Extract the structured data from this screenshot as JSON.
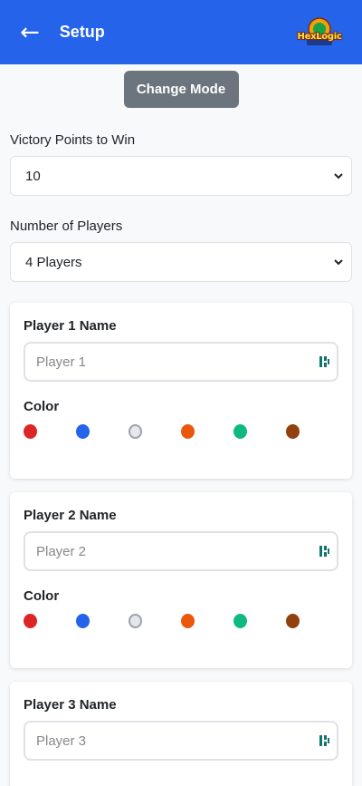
{
  "header": {
    "back_icon": "arrow-left-icon",
    "title": "Setup",
    "logo_text": "HexLogic"
  },
  "change_mode_label": "Change Mode",
  "victory": {
    "label": "Victory Points to Win",
    "value": "10"
  },
  "players_count": {
    "label": "Number of Players",
    "value": "4 Players"
  },
  "players": [
    {
      "name_label": "Player 1 Name",
      "placeholder": "Player 1",
      "color_label": "Color"
    },
    {
      "name_label": "Player 2 Name",
      "placeholder": "Player 2",
      "color_label": "Color"
    },
    {
      "name_label": "Player 3 Name",
      "placeholder": "Player 3",
      "color_label": "Color"
    }
  ],
  "color_options": [
    "#dc2626",
    "#2563eb",
    "#e5e7eb",
    "#ea580c",
    "#10b981",
    "#92400e"
  ],
  "colors": {
    "header_bg": "#2563eb",
    "change_mode_bg": "#6c757d"
  }
}
